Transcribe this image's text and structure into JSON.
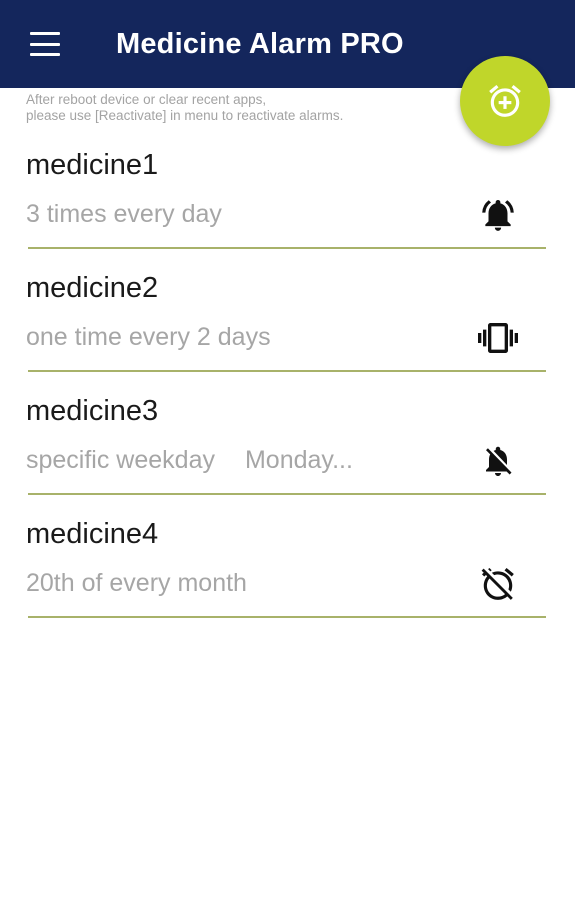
{
  "app": {
    "title": "Medicine Alarm PRO",
    "bar_color": "#14265c",
    "accent_color": "#c0d62a",
    "menu_icon": "hamburger-menu-icon",
    "fab_icon": "add-alarm-icon"
  },
  "notice": {
    "line1": "After reboot device or clear recent apps,",
    "line2": "please use [Reactivate] in menu to reactivate alarms."
  },
  "medicines": [
    {
      "name": "medicine1",
      "schedule": "3 times every day",
      "detail": "",
      "icon": "bell-ringing-icon"
    },
    {
      "name": "medicine2",
      "schedule": "one time every 2 days",
      "detail": "",
      "icon": "vibrate-icon"
    },
    {
      "name": "medicine3",
      "schedule": "specific weekday",
      "detail": "Monday...",
      "icon": "bell-off-icon"
    },
    {
      "name": "medicine4",
      "schedule": "20th of every month",
      "detail": "",
      "icon": "alarm-off-icon"
    }
  ]
}
